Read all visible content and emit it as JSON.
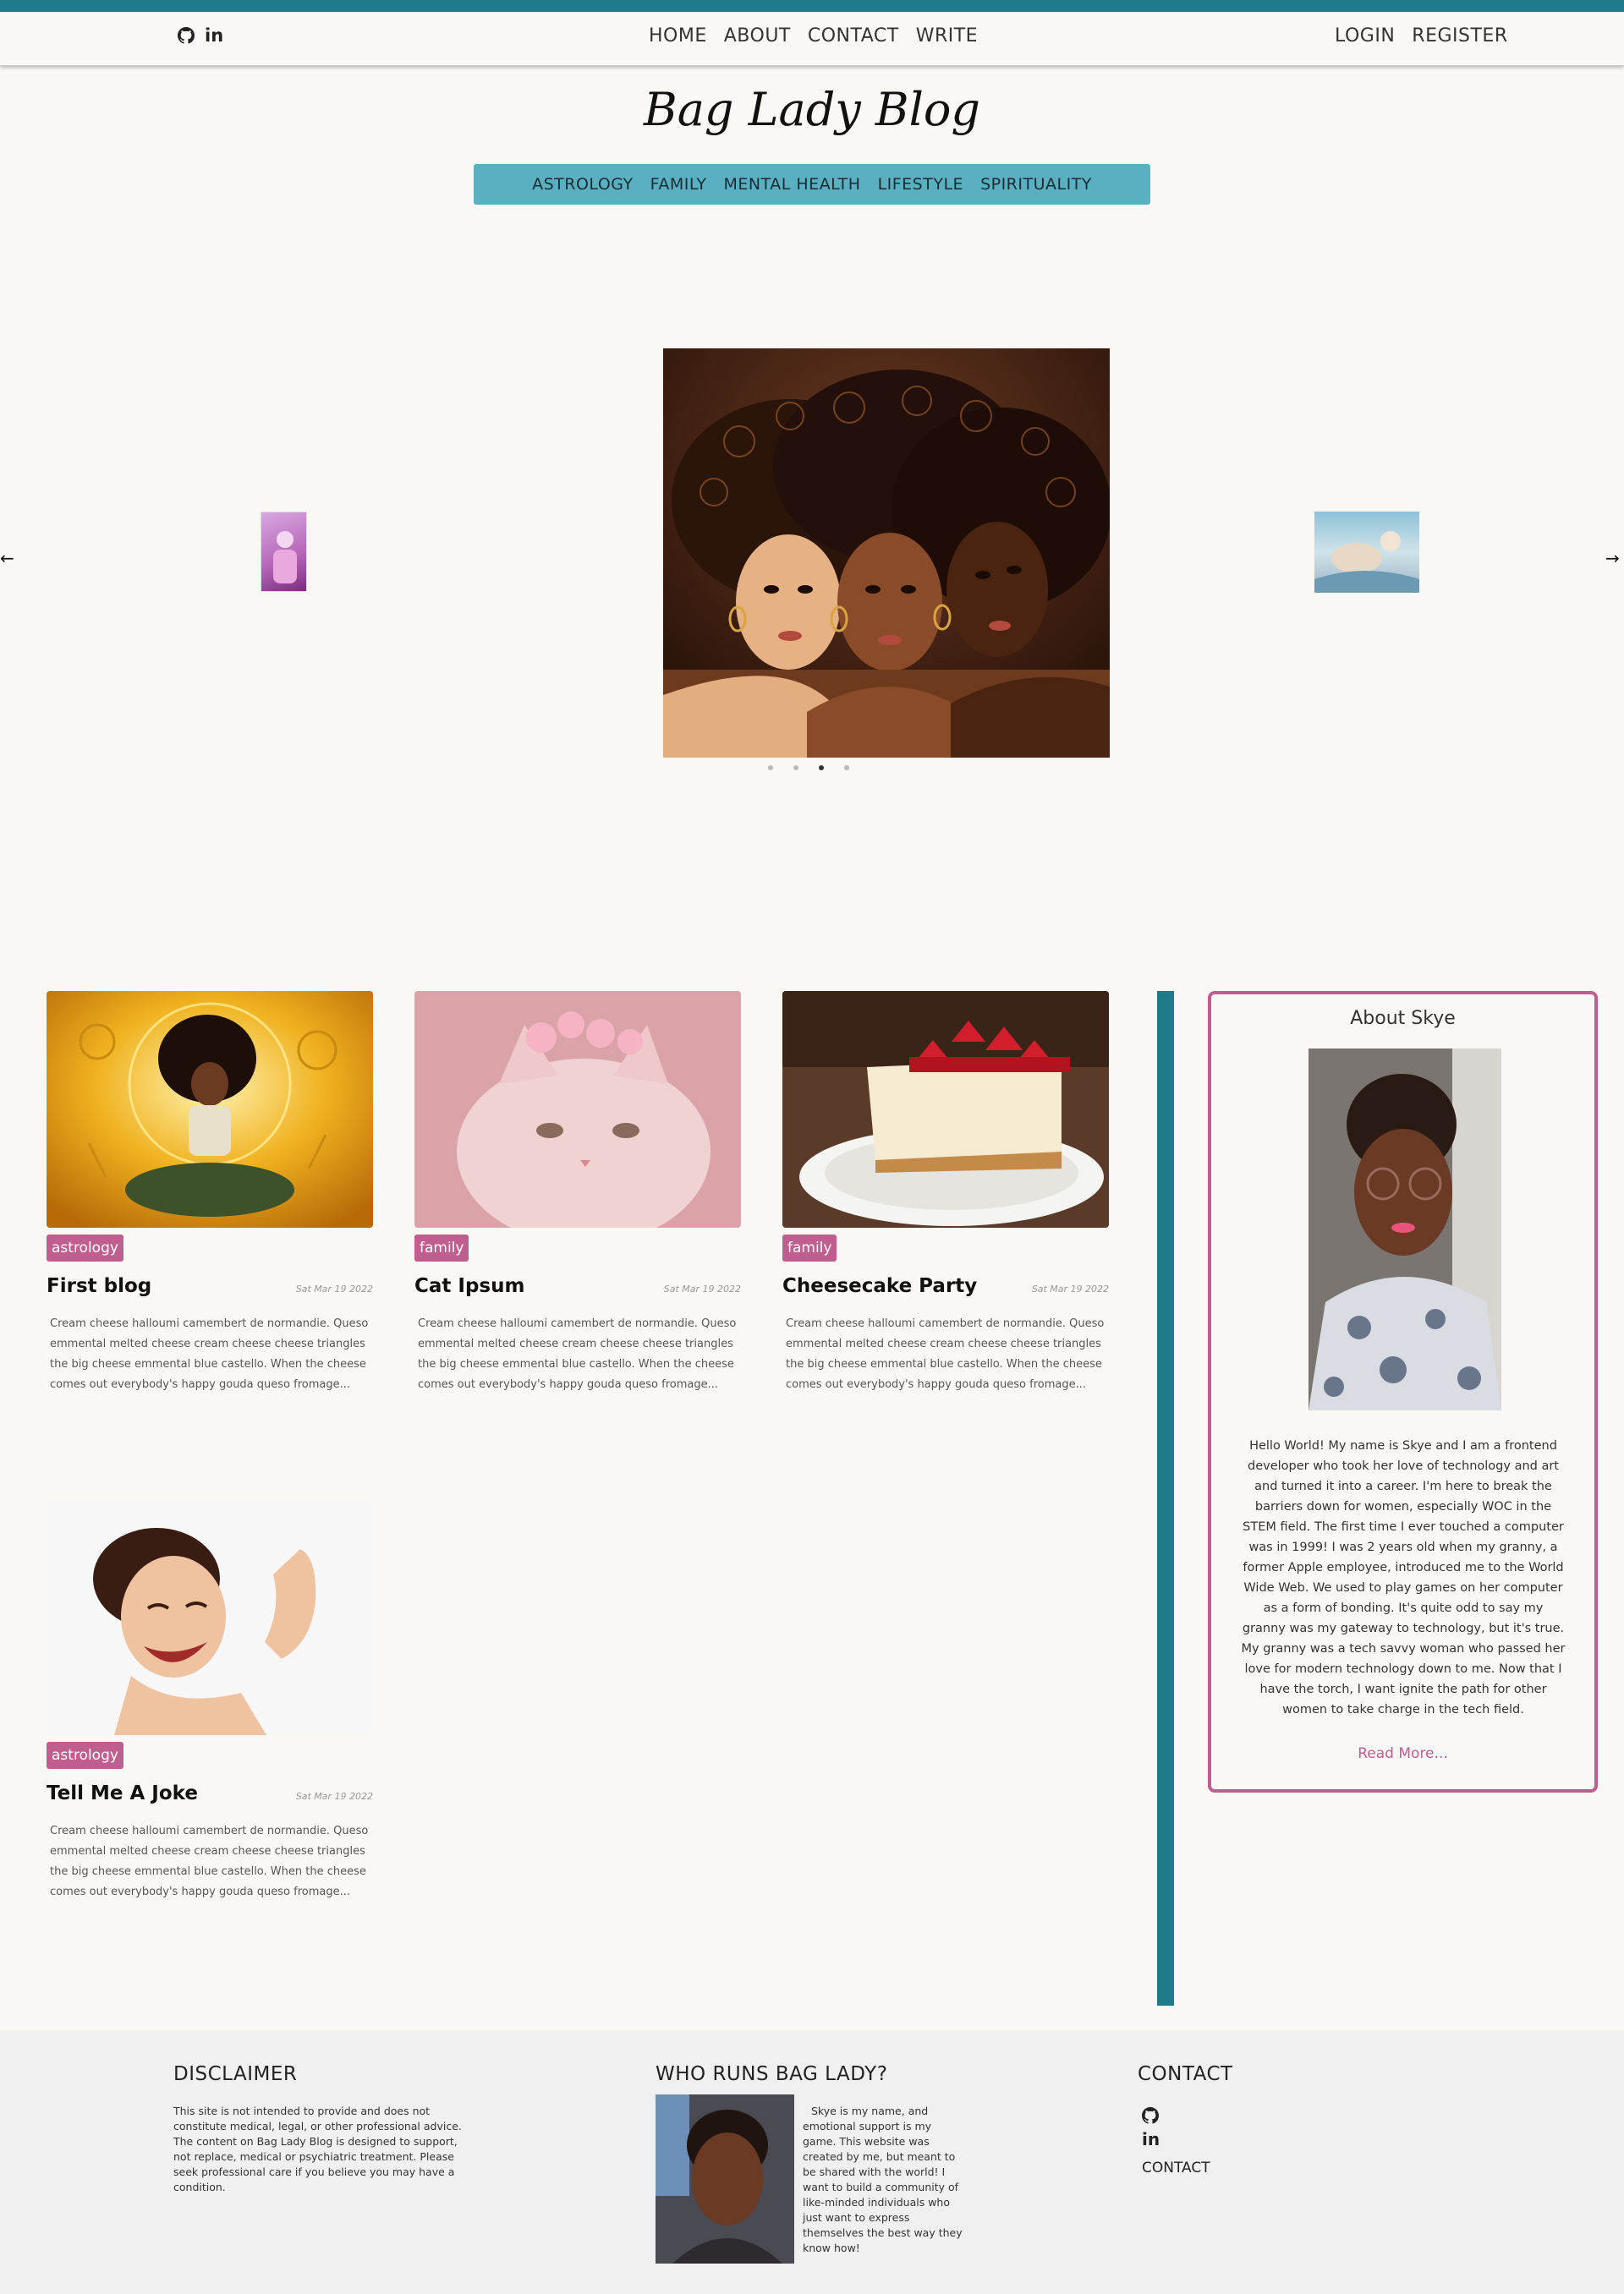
{
  "nav": {
    "left_icons": [
      "github-icon",
      "linkedin-icon"
    ],
    "linkedin_text": "in",
    "center_links": [
      "HOME",
      "ABOUT",
      "CONTACT",
      "WRITE"
    ],
    "right_links": [
      "LOGIN",
      "REGISTER"
    ]
  },
  "brand": {
    "title": "Bag Lady Blog"
  },
  "categories": [
    "ASTROLOGY",
    "FAMILY",
    "MENTAL HEALTH",
    "LIFESTYLE",
    "SPIRITUALITY"
  ],
  "carousel": {
    "prev_icon": "arrow-left-icon",
    "next_icon": "arrow-right-icon",
    "prev_glyph": "←",
    "next_glyph": "→",
    "slide_count": 4,
    "active_index": 2
  },
  "posts": [
    {
      "tag": "astrology",
      "title": "First blog",
      "date": "Sat Mar 19 2022",
      "excerpt": "Cream cheese halloumi camembert de normandie. Queso emmental melted cheese cream cheese cheese triangles the big cheese emmental blue castello. When the cheese comes out everybody's happy gouda queso fromage..."
    },
    {
      "tag": "family",
      "title": "Cat Ipsum",
      "date": "Sat Mar 19 2022",
      "excerpt": "Cream cheese halloumi camembert de normandie. Queso emmental melted cheese cream cheese cheese triangles the big cheese emmental blue castello. When the cheese comes out everybody's happy gouda queso fromage..."
    },
    {
      "tag": "family",
      "title": "Cheesecake Party",
      "date": "Sat Mar 19 2022",
      "excerpt": "Cream cheese halloumi camembert de normandie. Queso emmental melted cheese cream cheese cheese triangles the big cheese emmental blue castello. When the cheese comes out everybody's happy gouda queso fromage..."
    },
    {
      "tag": "astrology",
      "title": "Tell Me A Joke",
      "date": "Sat Mar 19 2022",
      "excerpt": "Cream cheese halloumi camembert de normandie. Queso emmental melted cheese cream cheese cheese triangles the big cheese emmental blue castello. When the cheese comes out everybody's happy gouda queso fromage..."
    }
  ],
  "about": {
    "title": "About Skye",
    "text": "Hello World! My name is Skye and I am a frontend developer who took her love of technology and art and turned it into a career. I'm here to break the barriers down for women, especially WOC in the STEM field. The first time I ever touched a computer was in 1999! I was 2 years old when my granny, a former Apple employee, introduced me to the World Wide Web. We used to play games on her computer as a form of bonding. It's quite odd to say my granny was my gateway to technology, but it's true. My granny was a tech savvy woman who passed her love for modern technology down to me. Now that I have the torch, I want ignite the path for other women to take charge in the tech field.",
    "read_more": "Read More..."
  },
  "footer": {
    "disclaimer_title": "DISCLAIMER",
    "disclaimer_text": "This site is not intended to provide and does not constitute medical, legal, or other professional advice. The content on Bag Lady Blog is designed to support, not replace, medical or psychiatric treatment. Please seek professional care if you believe you may have a condition.",
    "who_title": "WHO RUNS BAG LADY?",
    "who_text": "Skye is my name, and emotional support is my game. This website was created by me, but meant to be shared with the world! I want to build a community of like-minded individuals who just want to express themselves the best way they know how!",
    "contact_title": "CONTACT",
    "contact_icons": [
      "github-icon",
      "linkedin-icon"
    ],
    "linkedin_text": "in",
    "contact_link": "CONTACT"
  },
  "colors": {
    "accent_teal": "#1f7a8c",
    "category_bar": "#5ab0c1",
    "tag_pink": "#c05f8f"
  }
}
